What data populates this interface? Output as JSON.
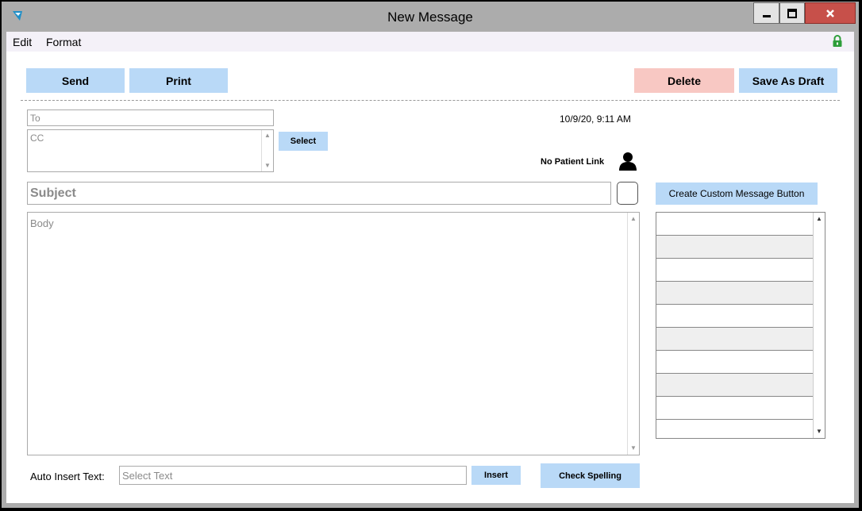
{
  "window": {
    "title": "New Message"
  },
  "menu": {
    "items": [
      "Edit",
      "Format"
    ]
  },
  "toolbar": {
    "send": "Send",
    "print": "Print",
    "delete": "Delete",
    "save_draft": "Save As Draft"
  },
  "header": {
    "timestamp": "10/9/20, 9:11 AM",
    "patient_link": "No Patient Link"
  },
  "fields": {
    "to_placeholder": "To",
    "cc_placeholder": "CC",
    "subject_placeholder": "Subject",
    "body_placeholder": "Body",
    "auto_insert_placeholder": "Select Text"
  },
  "buttons": {
    "select": "Select",
    "create_custom": "Create Custom Message Button",
    "insert": "Insert",
    "check_spelling": "Check Spelling"
  },
  "labels": {
    "auto_insert": "Auto Insert Text:"
  },
  "custom_buttons_list": {
    "rows": 9
  },
  "colors": {
    "primary_button": "#b9d9f7",
    "delete_button": "#f8c8c3",
    "title_bar": "#acacac",
    "menu_bar": "#f4f1f8",
    "lock_icon": "#2e9e3a",
    "close_button": "#c7504a"
  },
  "icons": {
    "app": "app-logo-icon",
    "lock": "lock-icon",
    "person": "person-icon"
  }
}
